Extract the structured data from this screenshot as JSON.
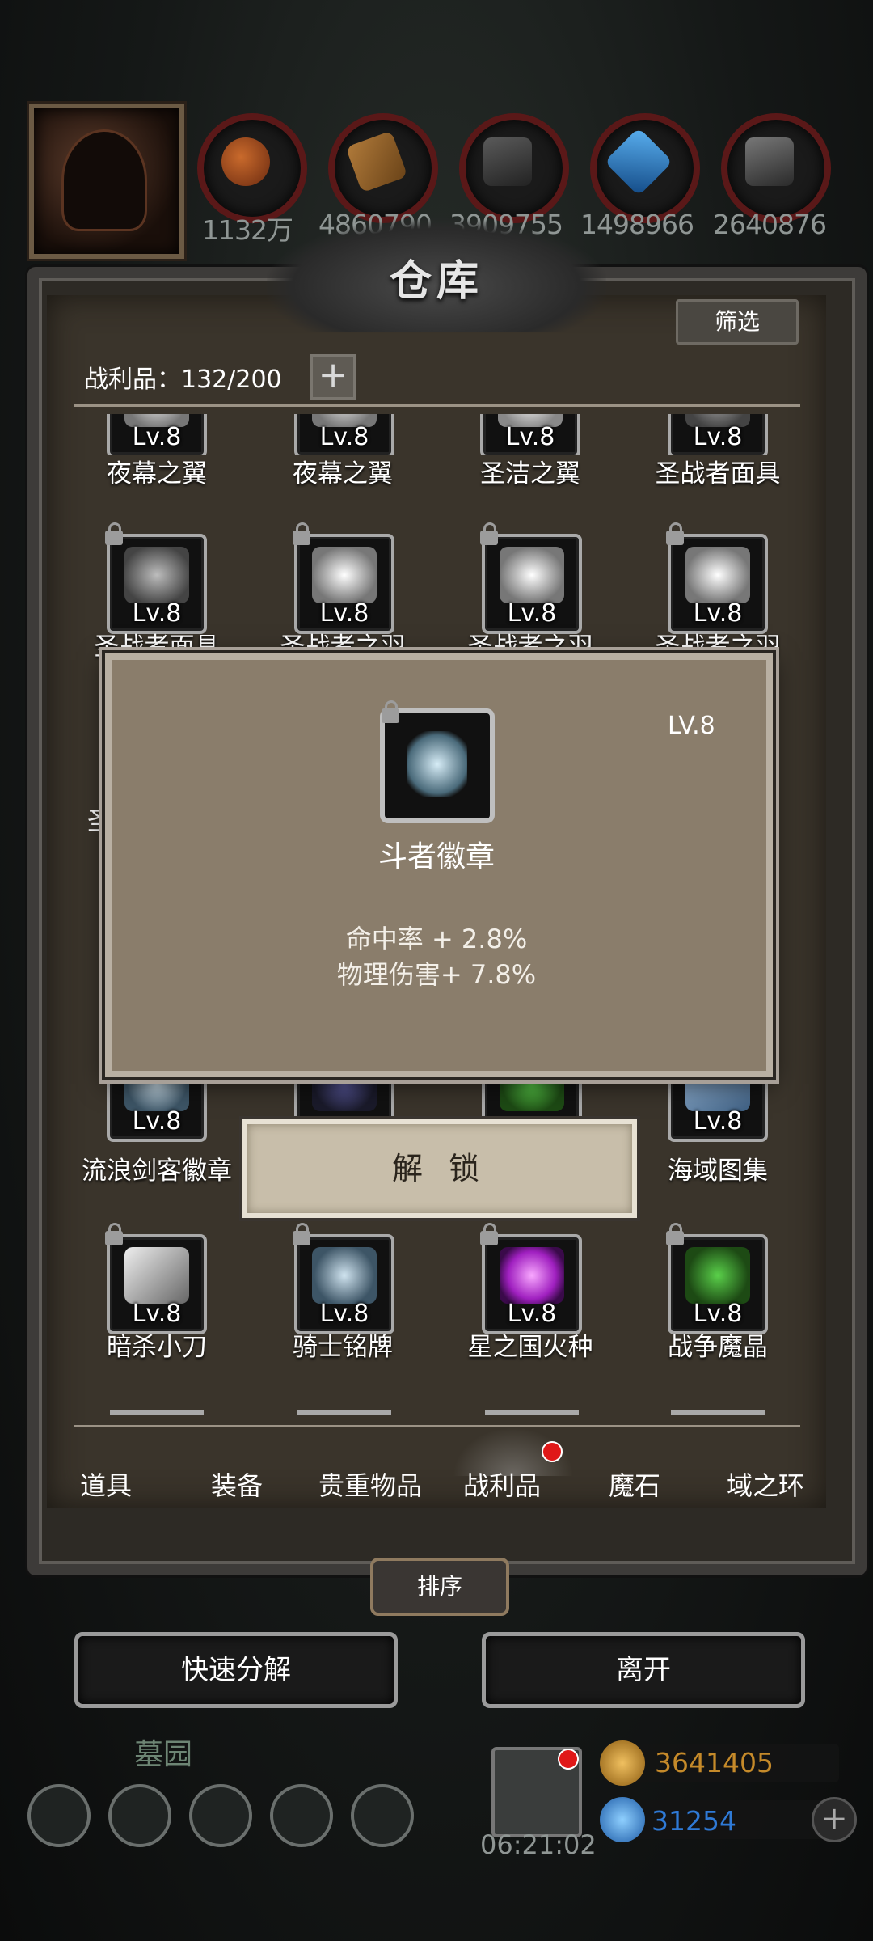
{
  "resources": [
    "1132万",
    "4860790",
    "3909755",
    "1498966",
    "2640876"
  ],
  "panel": {
    "title": "仓库",
    "filter_label": "筛选",
    "capacity": "战利品：132/200"
  },
  "rows": [
    [
      "夜幕之翼",
      "夜幕之翼",
      "圣洁之翼",
      "圣战者面具"
    ],
    [
      "圣战者面具",
      "圣战者之羽",
      "圣战者之羽",
      "圣战者之羽"
    ],
    [
      "流浪剑客徽章",
      "",
      "",
      "海域图集"
    ],
    [
      "暗杀小刀",
      "骑士铭牌",
      "星之国火种",
      "战争魔晶"
    ]
  ],
  "partial_left_label": "圣",
  "level": "Lv.8",
  "tooltip": {
    "level": "LV.8",
    "name": "斗者徽章",
    "stats": [
      "命中率 + 2.8%",
      "物理伤害+ 7.8%"
    ]
  },
  "unlock_label": "解 锁",
  "tabs": [
    "道具",
    "装备",
    "贵重物品",
    "战利品",
    "魔石",
    "域之环"
  ],
  "active_tab": "战利品",
  "sort_label": "排序",
  "quick_decompose_label": "快速分解",
  "leave_label": "离开",
  "footer": {
    "location": "墓园",
    "timer": "06:21:02",
    "gold": "3641405",
    "gems": "31254"
  },
  "colors": {
    "accent_red": "#e01818",
    "gold": "#c58a2a",
    "gem": "#2f7ad6",
    "panel_bg": "#3a342b"
  }
}
